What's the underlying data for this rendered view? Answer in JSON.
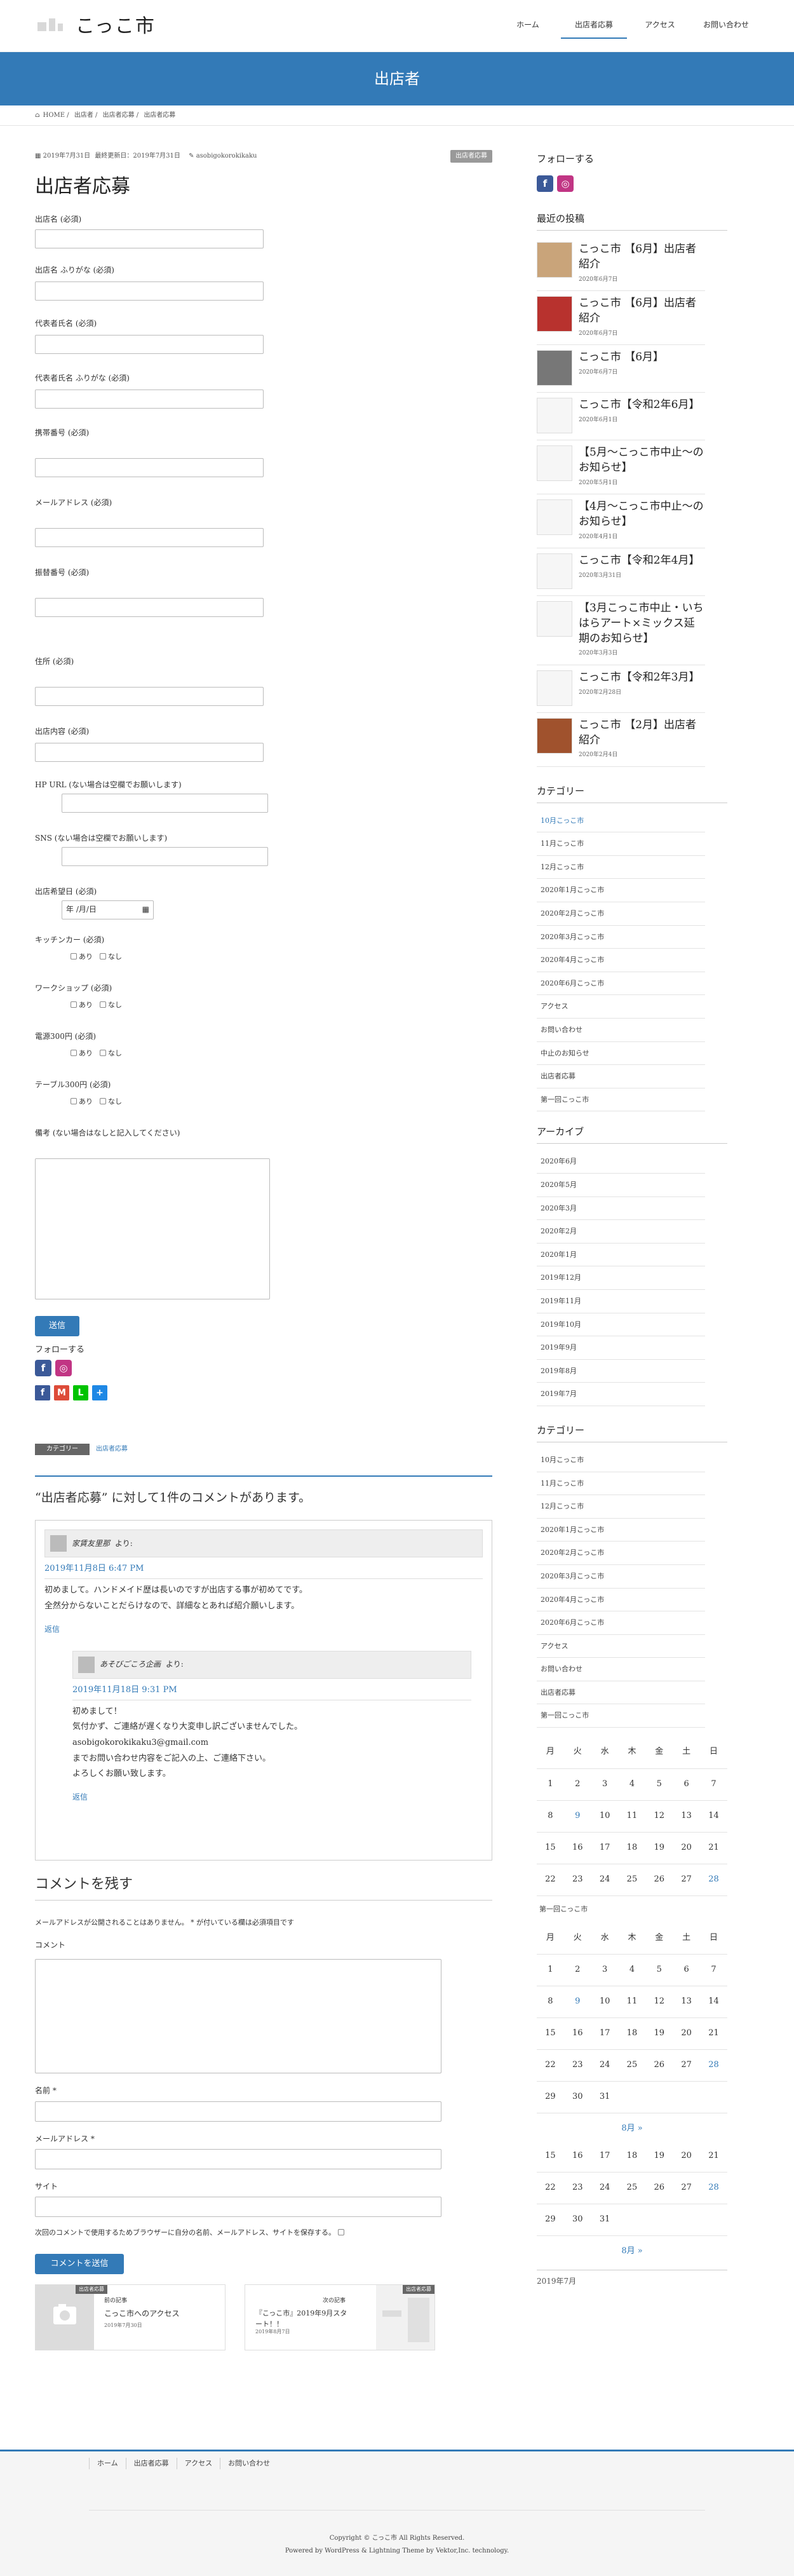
{
  "header": {
    "site_name": "こっこ市",
    "nav": [
      "ホーム",
      "出店者応募",
      "アクセス",
      "お問い合わせ"
    ]
  },
  "page_header": {
    "title": "出店者"
  },
  "breadcrumb": [
    "HOME",
    "出店者",
    "出店者応募",
    "出店者応募"
  ],
  "article": {
    "posted": "2019年7月31日",
    "updated": "最終更新日：2019年7月31日",
    "author": "asobigokorokikaku",
    "category_badge": "出店者応募",
    "title": "出店者応募",
    "fields": [
      {
        "label": "出店名 (必須)"
      },
      {
        "label": "出店名 ふりがな (必須)"
      },
      {
        "label": "代表者氏名 (必須)"
      },
      {
        "label": "代表者氏名 ふりがな (必須)"
      },
      {
        "label": "携帯番号 (必須)"
      },
      {
        "label": "メールアドレス (必須)"
      },
      {
        "label": "振替番号 (必須)"
      },
      {
        "label": "住所 (必須)"
      },
      {
        "label": "出店内容 (必須)"
      },
      {
        "label": "HP URL (ない場合は空欄でお願いします)"
      },
      {
        "label": "SNS (ない場合は空欄でお願いします)"
      },
      {
        "label": "出店希望日 (必須)"
      }
    ],
    "date_placeholder": "年 /月/日",
    "checks": [
      {
        "label": "キッチンカー (必須)"
      },
      {
        "label": "ワークショップ (必須)"
      },
      {
        "label": "電源300円 (必須)"
      },
      {
        "label": "テーブル300円 (必須)"
      }
    ],
    "opt_yes": "あり",
    "opt_no": "なし",
    "remarks_label": "備考 (ない場合はなしと記入してください)",
    "submit": "送信",
    "follow": "フォローする",
    "footer_cat_label": "カテゴリー",
    "footer_cat_value": "出店者応募"
  },
  "comments": {
    "heading": "“出店者応募” に対して1件のコメントがあります。",
    "c1": {
      "author": "家賃友里那",
      "says": "より:",
      "date": "2019年11月8日 6:47 PM",
      "lines": [
        "初めまして。ハンドメイド歴は長いのですが出店する事が初めてです。",
        "全然分からないことだらけなので、詳細なとあれば紹介願いします。"
      ],
      "reply": "返信"
    },
    "c2": {
      "author": "あそびごころ企画",
      "says": "より:",
      "date": "2019年11月18日 9:31 PM",
      "lines": [
        "初めまして！",
        "気付かず、ご連絡が遅くなり大変申し訳ございませんでした。",
        "asobigokorokikaku3@gmail.com",
        "までお問い合わせ内容をご記入の上、ご連絡下さい。",
        "よろしくお願い致します。"
      ],
      "reply": "返信"
    }
  },
  "leave": {
    "heading": "コメントを残す",
    "note": "メールアドレスが公開されることはありません。 * が付いている欄は必須項目です",
    "comment": "コメント",
    "name": "名前 *",
    "email": "メールアドレス *",
    "site": "サイト",
    "save": "次回のコメントで使用するためブラウザーに自分の名前、メールアドレス、サイトを保存する。",
    "submit": "コメントを送信"
  },
  "related": {
    "prev_tag": "出店者応募",
    "prev_label": "前の記事",
    "prev_title": "こっこ市へのアクセス",
    "prev_date": "2019年7月30日",
    "next_tag": "出店者応募",
    "next_label": "次の記事",
    "next_title": "『こっこ市』2019年9月スタート！！",
    "next_date": "2019年8月7日"
  },
  "sidebar": {
    "follow": "フォローする",
    "recent_title": "最近の投稿",
    "recent": [
      {
        "title": "こっこ市 【6月】出店者紹介",
        "date": "2020年6月7日"
      },
      {
        "title": "こっこ市 【6月】出店者紹介",
        "date": "2020年6月7日"
      },
      {
        "title": "こっこ市 【6月】",
        "date": "2020年6月7日"
      },
      {
        "title": "こっこ市【令和2年6月】",
        "date": "2020年6月1日"
      },
      {
        "title": "【5月〜こっこ市中止〜のお知らせ】",
        "date": "2020年5月1日"
      },
      {
        "title": "【4月〜こっこ市中止〜のお知らせ】",
        "date": "2020年4月1日"
      },
      {
        "title": "こっこ市【令和2年4月】",
        "date": "2020年3月31日"
      },
      {
        "title": "【3月こっこ市中止・いちはらアート×ミックス延期のお知らせ】",
        "date": "2020年3月3日"
      },
      {
        "title": "こっこ市【令和2年3月】",
        "date": "2020年2月28日"
      },
      {
        "title": "こっこ市 【2月】出店者紹介",
        "date": "2020年2月4日"
      }
    ],
    "cat_title": "カテゴリー",
    "categories": [
      "10月こっこ市",
      "11月こっこ市",
      "12月こっこ市",
      "2020年1月こっこ市",
      "2020年2月こっこ市",
      "2020年3月こっこ市",
      "2020年4月こっこ市",
      "2020年6月こっこ市",
      "アクセス",
      "お問い合わせ",
      "中止のお知らせ",
      "出店者応募",
      "第一回こっこ市"
    ],
    "archive_title": "アーカイブ",
    "archives": [
      "2020年6月",
      "2020年5月",
      "2020年3月",
      "2020年2月",
      "2020年1月",
      "2019年12月",
      "2019年11月",
      "2019年10月",
      "2019年9月",
      "2019年8月",
      "2019年7月"
    ],
    "cat2_title": "カテゴリー",
    "categories2": [
      "10月こっこ市",
      "11月こっこ市",
      "12月こっこ市",
      "2020年1月こっこ市",
      "2020年2月こっこ市",
      "2020年3月こっこ市",
      "2020年4月こっこ市",
      "2020年6月こっこ市",
      "アクセス",
      "お問い合わせ",
      "出店者応募",
      "第一回こっこ市"
    ],
    "weekdays": [
      "月",
      "火",
      "水",
      "木",
      "金",
      "土",
      "日"
    ],
    "cal1": [
      [
        "1",
        "2",
        "3",
        "4",
        "5",
        "6",
        "7"
      ],
      [
        "8",
        "9",
        "10",
        "11",
        "12",
        "13",
        "14"
      ],
      [
        "15",
        "16",
        "17",
        "18",
        "19",
        "20",
        "21"
      ],
      [
        "22",
        "23",
        "24",
        "25",
        "26",
        "27",
        "28"
      ]
    ],
    "between": "第一回こっこ市",
    "cal2": [
      [
        "1",
        "2",
        "3",
        "4",
        "5",
        "6",
        "7"
      ],
      [
        "8",
        "9",
        "10",
        "11",
        "12",
        "13",
        "14"
      ],
      [
        "15",
        "16",
        "17",
        "18",
        "19",
        "20",
        "21"
      ],
      [
        "22",
        "23",
        "24",
        "25",
        "26",
        "27",
        "28"
      ],
      [
        "29",
        "30",
        "31",
        "",
        "",
        "",
        ""
      ]
    ],
    "next1": "8月 »",
    "cal3": [
      [
        "15",
        "16",
        "17",
        "18",
        "19",
        "20",
        "21"
      ],
      [
        "22",
        "23",
        "24",
        "25",
        "26",
        "27",
        "28"
      ],
      [
        "29",
        "30",
        "31",
        "",
        "",
        "",
        ""
      ]
    ],
    "next2": "8月 »",
    "caption": "2019年7月"
  },
  "footer": {
    "nav": [
      "ホーム",
      "出店者応募",
      "アクセス",
      "お問い合わせ"
    ],
    "copyright": "Copyright © こっこ市 All Rights Reserved.",
    "powered": "Powered by WordPress & Lightning Theme by Vektor,Inc. technology."
  }
}
